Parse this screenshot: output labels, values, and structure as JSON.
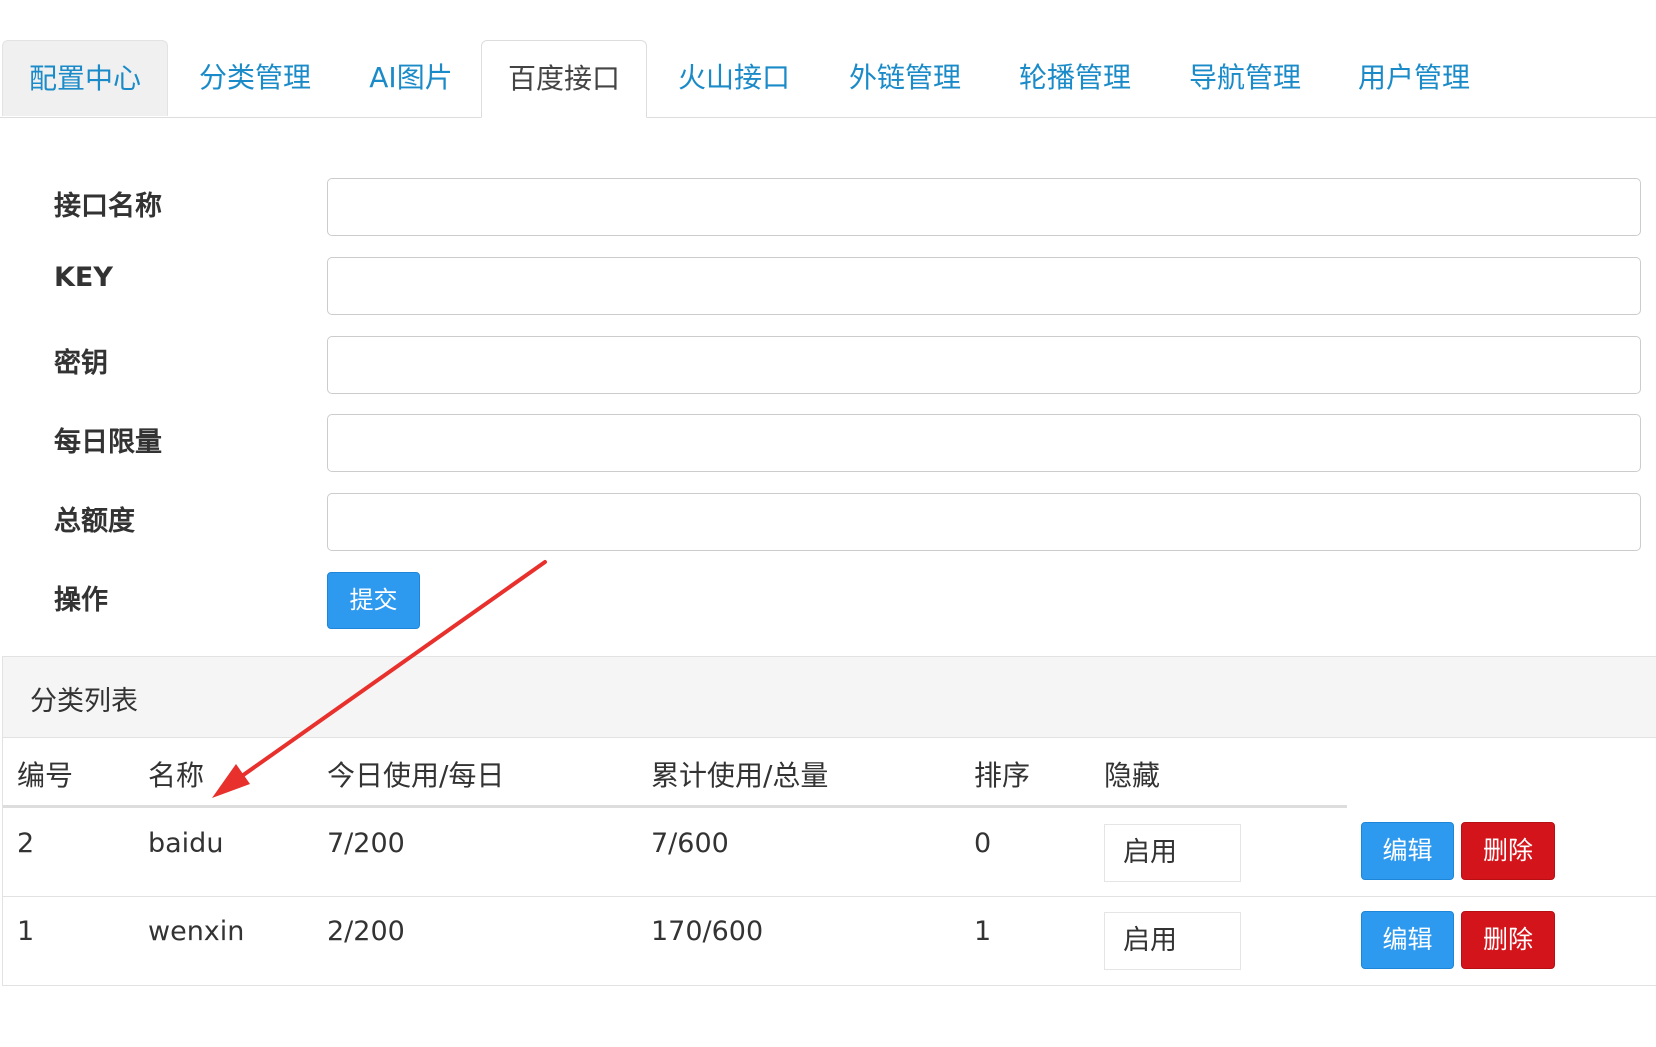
{
  "tabs": [
    {
      "label": "配置中心"
    },
    {
      "label": "分类管理"
    },
    {
      "label": "AI图片"
    },
    {
      "label": "百度接口"
    },
    {
      "label": "火山接口"
    },
    {
      "label": "外链管理"
    },
    {
      "label": "轮播管理"
    },
    {
      "label": "导航管理"
    },
    {
      "label": "用户管理"
    }
  ],
  "active_tab": "百度接口",
  "form": {
    "fields": [
      {
        "label": "接口名称",
        "value": ""
      },
      {
        "label": "KEY",
        "value": ""
      },
      {
        "label": "密钥",
        "value": ""
      },
      {
        "label": "每日限量",
        "value": ""
      },
      {
        "label": "总额度",
        "value": ""
      }
    ],
    "action_label": "操作",
    "submit_label": "提交"
  },
  "list": {
    "title": "分类列表",
    "columns": [
      "编号",
      "名称",
      "今日使用/每日",
      "累计使用/总量",
      "排序",
      "隐藏"
    ],
    "rows": [
      {
        "id": "2",
        "name": "baidu",
        "today": "7/200",
        "total": "7/600",
        "sort": "0",
        "hidden": "启用",
        "edit": "编辑",
        "delete": "删除"
      },
      {
        "id": "1",
        "name": "wenxin",
        "today": "2/200",
        "total": "170/600",
        "sort": "1",
        "hidden": "启用",
        "edit": "编辑",
        "delete": "删除"
      }
    ]
  },
  "colors": {
    "link": "#1a8bc8",
    "primary": "#2d9af0",
    "danger": "#d3151b",
    "annotation_arrow": "#e8302c"
  }
}
